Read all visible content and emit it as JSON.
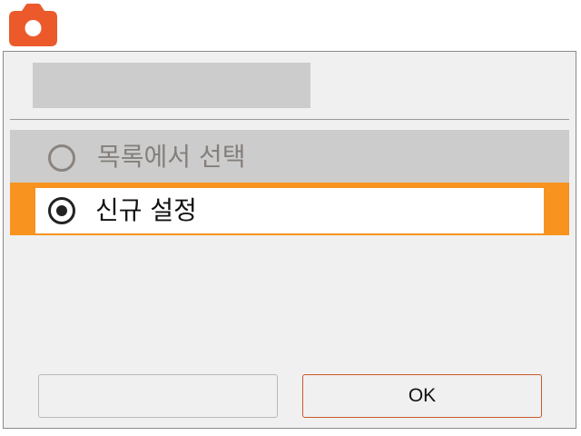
{
  "app": {
    "icon": "camera-icon",
    "accent_color": "#ec5a2b"
  },
  "dialog": {
    "title": "",
    "options": [
      {
        "label": "목록에서 선택",
        "selected": false
      },
      {
        "label": "신규 설정",
        "selected": true
      }
    ],
    "highlight_color": "#f7931e",
    "buttons": {
      "left_label": "",
      "ok_label": "OK"
    }
  }
}
